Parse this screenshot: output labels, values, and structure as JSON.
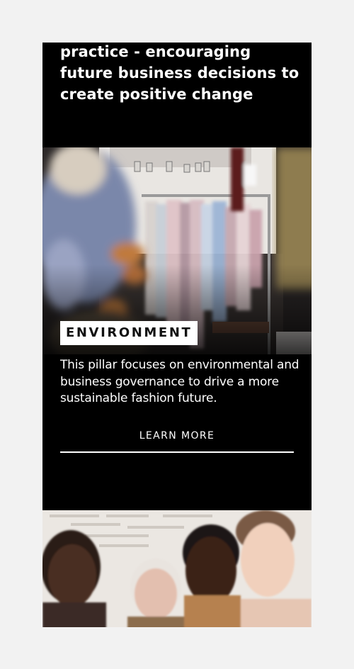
{
  "intro": {
    "text": "practice - encouraging future business decisions to create positive change"
  },
  "pillar": {
    "tag": "ENVIRONMENT",
    "description": "This pillar focuses on environmental and business governance to drive a more sustainable fashion future.",
    "cta": "LEARN MORE"
  },
  "images": {
    "rack_photo": "garment-rack-photo",
    "people_photo": "group-portrait-photo"
  }
}
